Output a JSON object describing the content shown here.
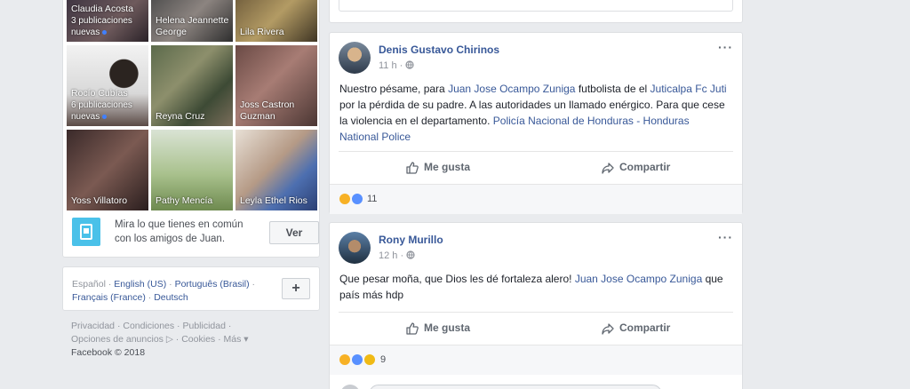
{
  "friends": [
    {
      "name": "Claudia Acosta",
      "sub": "3 publicaciones nuevas",
      "dot": true
    },
    {
      "name": "Helena Jeannette George",
      "sub": "",
      "dot": false
    },
    {
      "name": "Lila Rivera",
      "sub": "",
      "dot": false
    },
    {
      "name": "Rocío Cubías",
      "sub": "6 publicaciones nuevas",
      "dot": true
    },
    {
      "name": "Reyna Cruz",
      "sub": "",
      "dot": false
    },
    {
      "name": "Joss Castron Guzman",
      "sub": "",
      "dot": false
    },
    {
      "name": "Yoss Villatoro",
      "sub": "",
      "dot": false
    },
    {
      "name": "Pathy Mencía",
      "sub": "",
      "dot": false
    },
    {
      "name": "Leyla Ethel Rios",
      "sub": "",
      "dot": false
    }
  ],
  "common": {
    "text": "Mira lo que tienes en común con los amigos de Juan.",
    "button": "Ver"
  },
  "languages": {
    "current": "Español",
    "links": [
      "English (US)",
      "Português (Brasil)",
      "Français (France)",
      "Deutsch"
    ],
    "plus": "+"
  },
  "footer": {
    "line1": "Privacidad · Condiciones · Publicidad ·",
    "line2": "Opciones de anuncios ▷ · Cookies · Más ▾",
    "copyright": "Facebook © 2018"
  },
  "posts": [
    {
      "author": "Denis Gustavo Chirinos",
      "time": "11 h",
      "text_parts": [
        {
          "t": "Nuestro pésame, para ",
          "link": false
        },
        {
          "t": "Juan Jose Ocampo Zuniga",
          "link": true
        },
        {
          "t": " futbolista de el ",
          "link": false
        },
        {
          "t": "Juticalpa Fc Juti",
          "link": true
        },
        {
          "t": " por la pérdida de su padre. A las autoridades un llamado enérgico. Para que cese la violencia en el departamento. ",
          "link": false
        },
        {
          "t": "Policía Nacional de Honduras - Honduras National Police",
          "link": true
        }
      ],
      "like_label": "Me gusta",
      "share_label": "Compartir",
      "reaction_count": "11"
    },
    {
      "author": "Rony Murillo",
      "time": "12 h",
      "text_parts": [
        {
          "t": "Que pesar moña, que Dios les dé fortaleza alero! ",
          "link": false
        },
        {
          "t": "Juan Jose Ocampo Zuniga",
          "link": true
        },
        {
          "t": " que país más hdp",
          "link": false
        }
      ],
      "like_label": "Me gusta",
      "share_label": "Compartir",
      "reaction_count": "9"
    }
  ],
  "colors": {
    "link": "#385898",
    "background": "#e9ebee",
    "like": "#5890ff",
    "sad": "#f7b125"
  },
  "icons": {
    "globe": "globe-icon",
    "like": "thumbs-up-icon",
    "share": "share-arrow-icon",
    "more": "more-dots-icon"
  }
}
